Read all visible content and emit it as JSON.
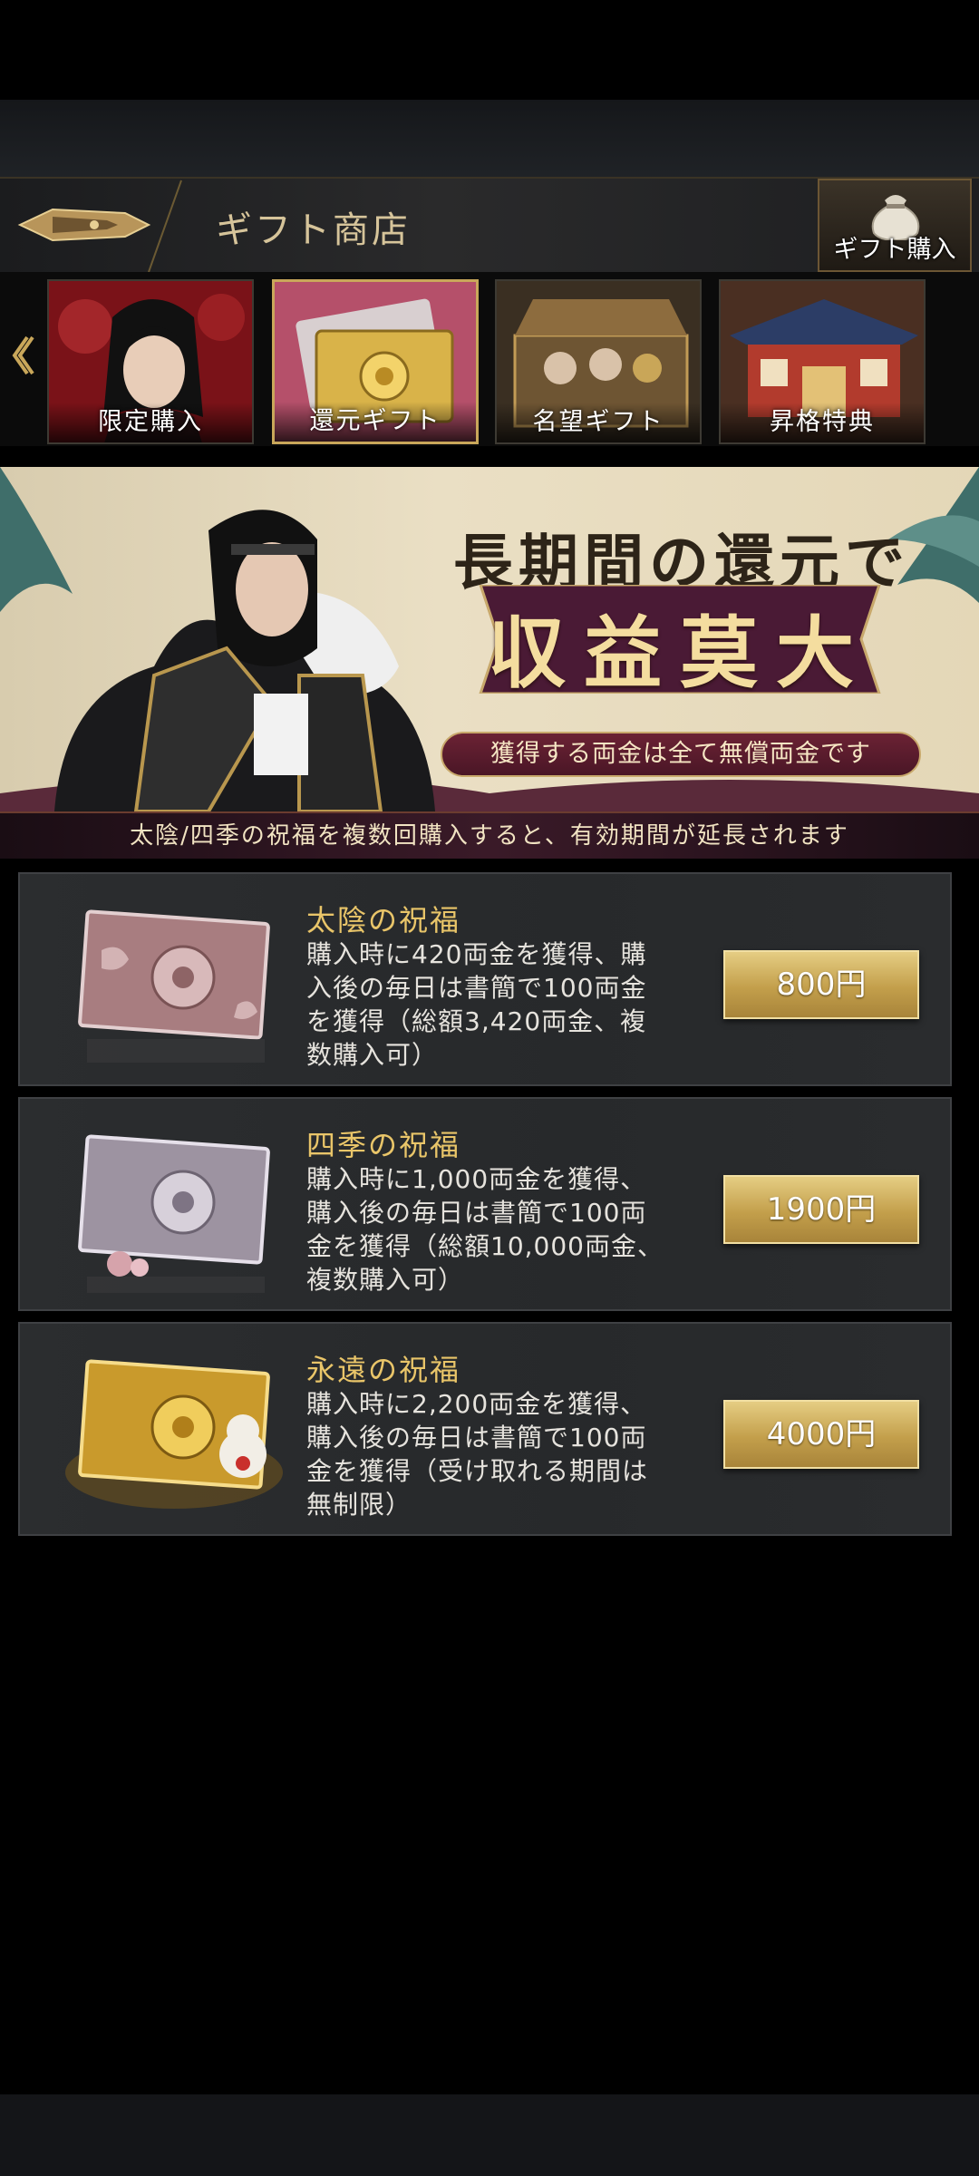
{
  "header": {
    "title": "ギフト商店",
    "gift_buy_label": "ギフト購入"
  },
  "tabs": [
    {
      "label": "限定購入",
      "active": false
    },
    {
      "label": "還元ギフト",
      "active": true
    },
    {
      "label": "名望ギフト",
      "active": false
    },
    {
      "label": "昇格特典",
      "active": false
    }
  ],
  "banner": {
    "headline": "長期間の還元で",
    "big": "収益莫大",
    "note": "獲得する両金は全て無償両金です"
  },
  "notice": "太陰/四季の祝福を複数回購入すると、有効期間が延長されます",
  "products": [
    {
      "name": "太陰の祝福",
      "desc": "購入時に420両金を獲得、購\n入後の毎日は書簡で100両金\nを獲得（総額3,420両金、複\n数購入可）",
      "price": "800円"
    },
    {
      "name": "四季の祝福",
      "desc": "購入時に1,000両金を獲得、\n購入後の毎日は書簡で100両\n金を獲得（総額10,000両金、\n複数購入可）",
      "price": "1900円"
    },
    {
      "name": "永遠の祝福",
      "desc": "購入時に2,200両金を獲得、\n購入後の毎日は書簡で100両\n金を獲得（受け取れる期間は\n無制限）",
      "price": "4000円"
    }
  ],
  "colors": {
    "accent_gold": "#e9c569",
    "price_button": "#c39f4b",
    "banner_plaque": "#4a1a35"
  }
}
